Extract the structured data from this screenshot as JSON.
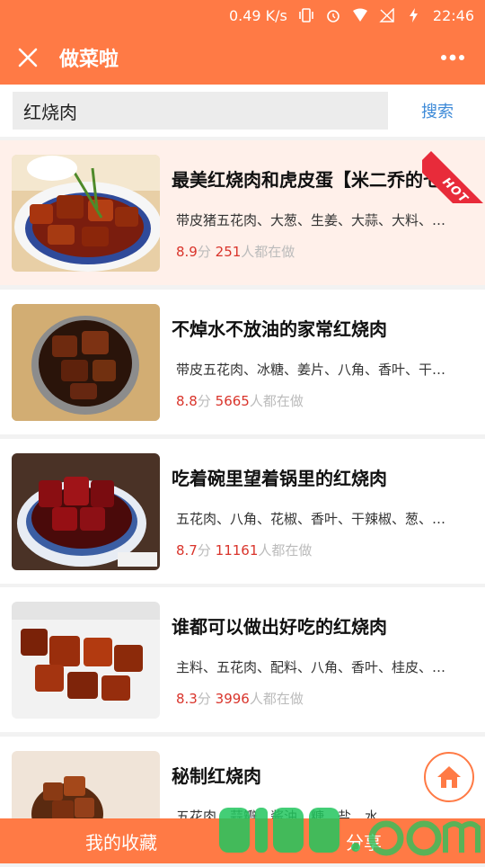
{
  "status_bar": {
    "net_speed": "0.49 K/s",
    "time": "22:46"
  },
  "app_bar": {
    "title": "做菜啦",
    "close_icon": "close-icon",
    "more_icon": "more-dots-icon"
  },
  "search": {
    "value": "红烧肉",
    "button_label": "搜索"
  },
  "recipes": [
    {
      "title": "最美红烧肉和虎皮蛋【米二乔的七…",
      "ingredients": "带皮猪五花肉、大葱、生姜、大蒜、大料、…",
      "rating": "8.9",
      "rating_unit": "分",
      "count": "251",
      "count_suffix": "人都在做",
      "hot": true,
      "hot_label": "HOT"
    },
    {
      "title": "不焯水不放油的家常红烧肉",
      "ingredients": "带皮五花肉、冰糖、姜片、八角、香叶、干…",
      "rating": "8.8",
      "rating_unit": "分",
      "count": "5665",
      "count_suffix": "人都在做",
      "hot": false
    },
    {
      "title": "吃着碗里望着锅里的红烧肉",
      "ingredients": "五花肉、八角、花椒、香叶、干辣椒、葱、…",
      "rating": "8.7",
      "rating_unit": "分",
      "count": "11161",
      "count_suffix": "人都在做",
      "hot": false
    },
    {
      "title": "谁都可以做出好吃的红烧肉",
      "ingredients": "主料、五花肉、配料、八角、香叶、桂皮、…",
      "rating": "8.3",
      "rating_unit": "分",
      "count": "3996",
      "count_suffix": "人都在做",
      "hot": false
    },
    {
      "title": "秘制红烧肉",
      "ingredients": "五花肉、蒜瓣、酱油、糖、盐、水",
      "rating": "",
      "rating_unit": "",
      "count": "",
      "count_suffix": "",
      "hot": false
    }
  ],
  "bottom_bar": {
    "favorites_label": "我的收藏",
    "share_label": "分享"
  },
  "home_button_icon": "home-icon",
  "colors": {
    "brand": "#ff7a45",
    "link": "#3d8ad8",
    "rating_red": "#d9342b",
    "hot_red": "#e82b3a"
  }
}
